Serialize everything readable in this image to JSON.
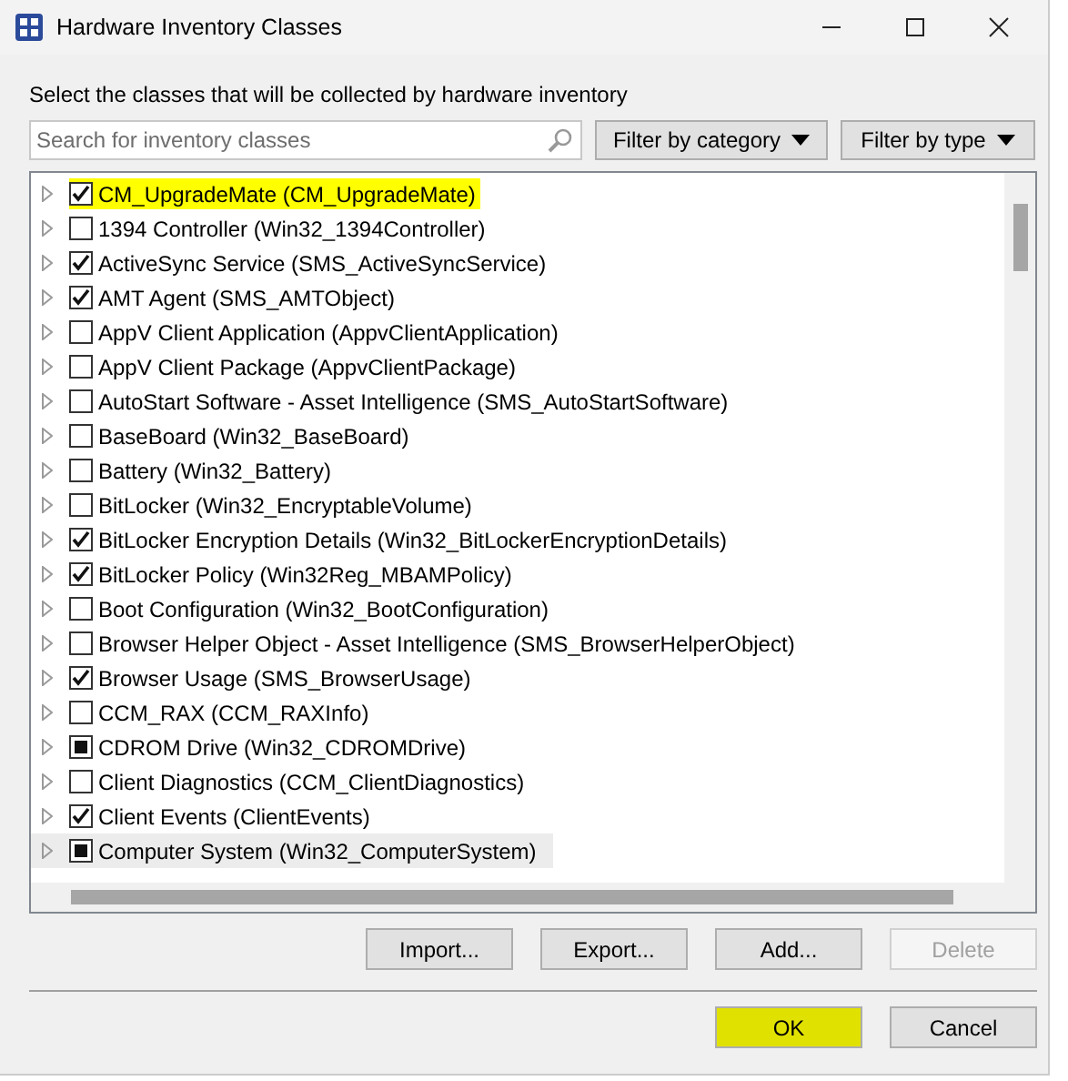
{
  "window": {
    "title": "Hardware Inventory Classes"
  },
  "instruction": "Select the classes that will be collected by hardware inventory",
  "search": {
    "placeholder": "Search for inventory classes"
  },
  "filters": [
    "Filter by category",
    "Filter by type"
  ],
  "classes": [
    {
      "label": "CM_UpgradeMate (CM_UpgradeMate)",
      "checked": true,
      "indeterminate": false,
      "highlighted": true,
      "hovered": false
    },
    {
      "label": "1394 Controller (Win32_1394Controller)",
      "checked": false,
      "indeterminate": false,
      "highlighted": false,
      "hovered": false
    },
    {
      "label": "ActiveSync Service (SMS_ActiveSyncService)",
      "checked": true,
      "indeterminate": false,
      "highlighted": false,
      "hovered": false
    },
    {
      "label": "AMT Agent (SMS_AMTObject)",
      "checked": true,
      "indeterminate": false,
      "highlighted": false,
      "hovered": false
    },
    {
      "label": "AppV Client Application (AppvClientApplication)",
      "checked": false,
      "indeterminate": false,
      "highlighted": false,
      "hovered": false
    },
    {
      "label": "AppV Client Package (AppvClientPackage)",
      "checked": false,
      "indeterminate": false,
      "highlighted": false,
      "hovered": false
    },
    {
      "label": "AutoStart Software - Asset Intelligence (SMS_AutoStartSoftware)",
      "checked": false,
      "indeterminate": false,
      "highlighted": false,
      "hovered": false
    },
    {
      "label": "BaseBoard (Win32_BaseBoard)",
      "checked": false,
      "indeterminate": false,
      "highlighted": false,
      "hovered": false
    },
    {
      "label": "Battery (Win32_Battery)",
      "checked": false,
      "indeterminate": false,
      "highlighted": false,
      "hovered": false
    },
    {
      "label": "BitLocker (Win32_EncryptableVolume)",
      "checked": false,
      "indeterminate": false,
      "highlighted": false,
      "hovered": false
    },
    {
      "label": "BitLocker Encryption Details (Win32_BitLockerEncryptionDetails)",
      "checked": true,
      "indeterminate": false,
      "highlighted": false,
      "hovered": false
    },
    {
      "label": "BitLocker Policy (Win32Reg_MBAMPolicy)",
      "checked": true,
      "indeterminate": false,
      "highlighted": false,
      "hovered": false
    },
    {
      "label": "Boot Configuration (Win32_BootConfiguration)",
      "checked": false,
      "indeterminate": false,
      "highlighted": false,
      "hovered": false
    },
    {
      "label": "Browser Helper Object - Asset Intelligence (SMS_BrowserHelperObject)",
      "checked": false,
      "indeterminate": false,
      "highlighted": false,
      "hovered": false
    },
    {
      "label": "Browser Usage (SMS_BrowserUsage)",
      "checked": true,
      "indeterminate": false,
      "highlighted": false,
      "hovered": false
    },
    {
      "label": "CCM_RAX (CCM_RAXInfo)",
      "checked": false,
      "indeterminate": false,
      "highlighted": false,
      "hovered": false
    },
    {
      "label": "CDROM Drive (Win32_CDROMDrive)",
      "indeterminate": true,
      "highlighted": false,
      "hovered": false
    },
    {
      "label": "Client Diagnostics (CCM_ClientDiagnostics)",
      "checked": false,
      "indeterminate": false,
      "highlighted": false,
      "hovered": false
    },
    {
      "label": "Client Events (ClientEvents)",
      "checked": true,
      "indeterminate": false,
      "highlighted": false,
      "hovered": false
    },
    {
      "label": "Computer System (Win32_ComputerSystem)",
      "indeterminate": true,
      "highlighted": false,
      "hovered": true
    }
  ],
  "list_buttons": [
    {
      "label": "Import...",
      "disabled": false
    },
    {
      "label": "Export...",
      "disabled": false
    },
    {
      "label": "Add...",
      "disabled": false
    },
    {
      "label": "Delete",
      "disabled": true
    }
  ],
  "dialog_buttons": [
    {
      "label": "OK",
      "highlighted": true
    },
    {
      "label": "Cancel",
      "highlighted": false
    }
  ]
}
